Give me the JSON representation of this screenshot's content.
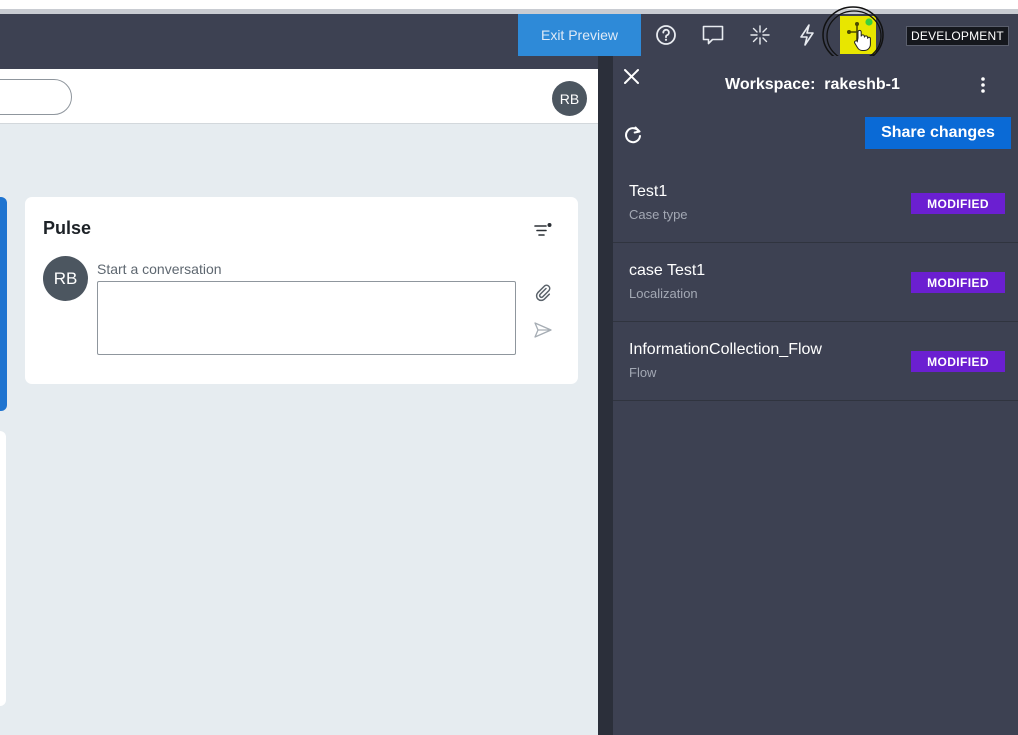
{
  "toolbar": {
    "exit_preview_label": "Exit Preview",
    "icons": [
      "help-icon",
      "comment-icon",
      "sparkle-icon",
      "lightning-icon",
      "branch-icon"
    ],
    "environment_badge": "DEVELOPMENT",
    "highlight_color": "#e8e600",
    "branch_status_dot_color": "#3ccf3c"
  },
  "preview": {
    "header_avatar": "RB",
    "pulse": {
      "title": "Pulse",
      "avatar_initials": "RB",
      "conversation_label": "Start a conversation",
      "conversation_value": ""
    }
  },
  "workspace_panel": {
    "title": "Workspace:  rakeshb-1",
    "share_button_label": "Share changes",
    "changes": [
      {
        "name": "Test1",
        "type": "Case type",
        "status": "MODIFIED"
      },
      {
        "name": "case Test1",
        "type": "Localization",
        "status": "MODIFIED"
      },
      {
        "name": "InformationCollection_Flow",
        "type": "Flow",
        "status": "MODIFIED"
      }
    ]
  },
  "colors": {
    "accent_blue": "#0a6ad6",
    "modified_badge": "#6b1fd1",
    "panel_background": "#3d4152"
  }
}
